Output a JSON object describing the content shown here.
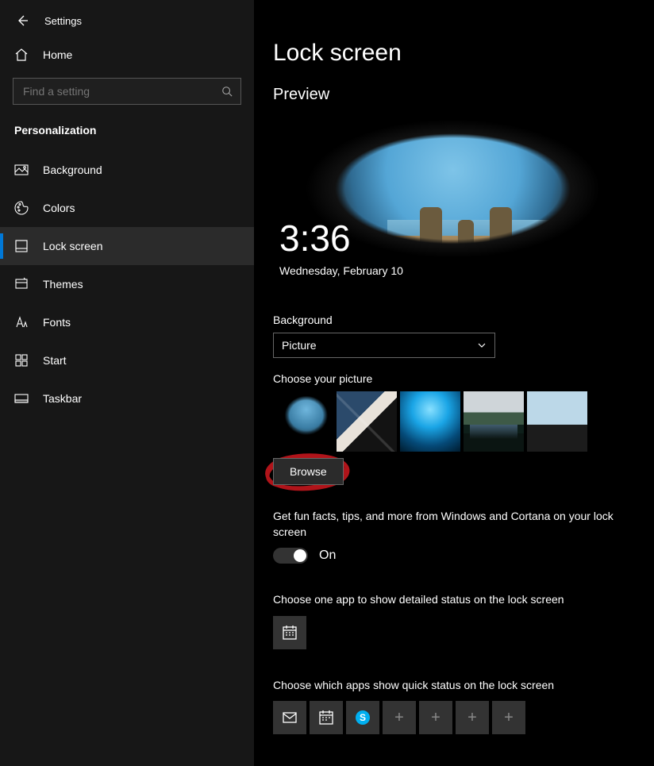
{
  "header": {
    "title": "Settings"
  },
  "home_label": "Home",
  "search": {
    "placeholder": "Find a setting"
  },
  "section": "Personalization",
  "nav": [
    {
      "label": "Background"
    },
    {
      "label": "Colors"
    },
    {
      "label": "Lock screen"
    },
    {
      "label": "Themes"
    },
    {
      "label": "Fonts"
    },
    {
      "label": "Start"
    },
    {
      "label": "Taskbar"
    }
  ],
  "nav_selected_index": 2,
  "page": {
    "title": "Lock screen",
    "preview_label": "Preview",
    "preview_time": "3:36",
    "preview_date": "Wednesday, February 10",
    "background_label": "Background",
    "background_value": "Picture",
    "choose_picture_label": "Choose your picture",
    "browse_label": "Browse",
    "fun_facts_label": "Get fun facts, tips, and more from Windows and Cortana on your lock screen",
    "fun_facts_state": "On",
    "detailed_status_label": "Choose one app to show detailed status on the lock screen",
    "quick_status_label": "Choose which apps show quick status on the lock screen",
    "detailed_apps": [
      "calendar"
    ],
    "quick_apps": [
      "mail",
      "calendar",
      "skype",
      "add",
      "add",
      "add",
      "add"
    ]
  },
  "annotation": {
    "highlight": "browse-button",
    "style": "red-marker-circle"
  }
}
